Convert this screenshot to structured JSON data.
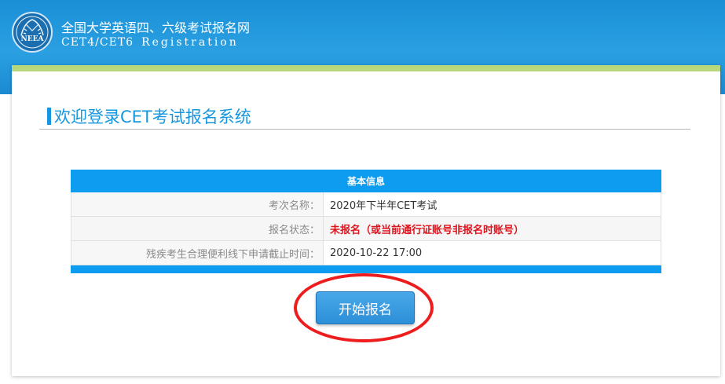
{
  "header": {
    "logo_text": "NEEA",
    "title": "全国大学英语四、六级考试报名网",
    "subtitle_main": "CET4/CET6",
    "subtitle_reg": "Registration"
  },
  "welcome": {
    "title": "欢迎登录CET考试报名系统"
  },
  "info": {
    "header": "基本信息",
    "rows": [
      {
        "label": "考次名称：",
        "value": "2020年下半年CET考试"
      },
      {
        "label": "报名状态：",
        "value": "未报名（或当前通行证账号非报名时账号）"
      },
      {
        "label": "残疾考生合理便利线下申请截止时间：",
        "value": "2020-10-22 17:00"
      }
    ]
  },
  "actions": {
    "start_label": "开始报名"
  },
  "colors": {
    "accent": "#1596df",
    "green_bar": "#b6d77a",
    "status_red": "#e0141e",
    "highlight": "#ee1d1d"
  }
}
